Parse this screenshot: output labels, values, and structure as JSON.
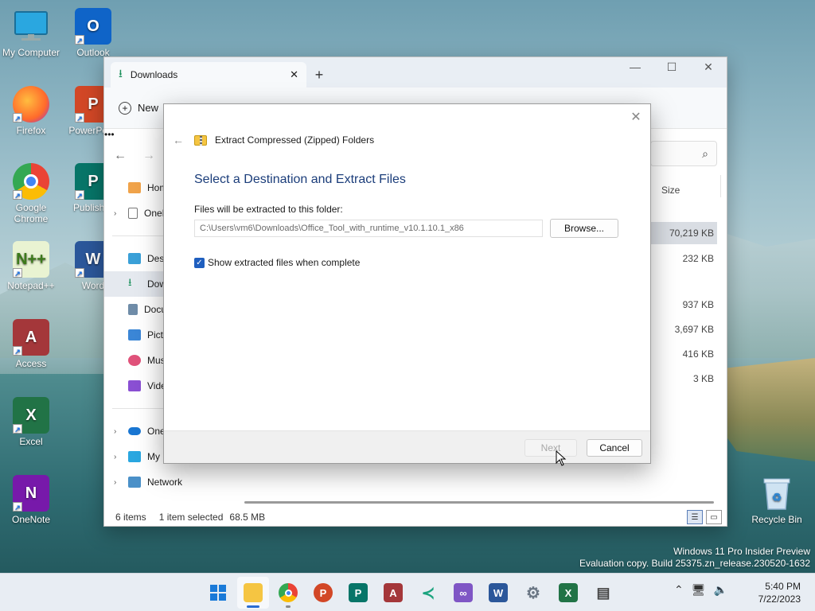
{
  "desktop": {
    "icons": [
      {
        "label": "My Computer"
      },
      {
        "label": "Outlook"
      },
      {
        "label": "Firefox"
      },
      {
        "label": "PowerPoint"
      },
      {
        "label": "Google Chrome"
      },
      {
        "label": "Publisher"
      },
      {
        "label": "Notepad++"
      },
      {
        "label": "Word"
      },
      {
        "label": "Access"
      },
      {
        "label": "Excel"
      },
      {
        "label": "OneNote"
      },
      {
        "label": "Recycle Bin"
      }
    ]
  },
  "explorer": {
    "tab_title": "Downloads",
    "new_label": "New",
    "size_header": "Size",
    "sizes": [
      "70,219 KB",
      "232 KB",
      "937 KB",
      "3,697 KB",
      "416 KB",
      "3 KB"
    ],
    "sidebar": {
      "items": [
        {
          "label": "Home"
        },
        {
          "label": "OneDrive"
        },
        {
          "label": "Desktop"
        },
        {
          "label": "Downloads"
        },
        {
          "label": "Documents"
        },
        {
          "label": "Pictures"
        },
        {
          "label": "Music"
        },
        {
          "label": "Videos"
        },
        {
          "label": "OneDrive"
        },
        {
          "label": "My Computer"
        },
        {
          "label": "Network"
        }
      ]
    },
    "status": {
      "items_count": "6 items",
      "selected": "1 item selected",
      "selected_size": "68.5 MB"
    }
  },
  "dialog": {
    "title": "Extract Compressed (Zipped) Folders",
    "heading": "Select a Destination and Extract Files",
    "folder_label": "Files will be extracted to this folder:",
    "path_value": "C:\\Users\\vm6\\Downloads\\Office_Tool_with_runtime_v10.1.10.1_x86",
    "browse_label": "Browse...",
    "checkbox_label": "Show extracted files when complete",
    "checkbox_checked": true,
    "next_label": "Next",
    "cancel_label": "Cancel"
  },
  "watermark": {
    "line1": "Windows 11 Pro Insider Preview",
    "line2": "Evaluation copy. Build 25375.zn_release.230520-1632"
  },
  "taskbar": {
    "apps": [
      {
        "name": "start-icon"
      },
      {
        "name": "file-explorer-icon"
      },
      {
        "name": "chrome-icon"
      },
      {
        "name": "powerpoint-icon"
      },
      {
        "name": "publisher-icon"
      },
      {
        "name": "access-icon"
      },
      {
        "name": "vscode-icon"
      },
      {
        "name": "visual-studio-icon"
      },
      {
        "name": "word-icon"
      },
      {
        "name": "settings-icon"
      },
      {
        "name": "excel-icon"
      },
      {
        "name": "notepad-icon"
      }
    ],
    "clock": {
      "time": "5:40 PM",
      "date": "7/22/2023"
    }
  },
  "colors": {
    "accent": "#1f5fbf",
    "dialog_heading": "#1b3d7a"
  }
}
